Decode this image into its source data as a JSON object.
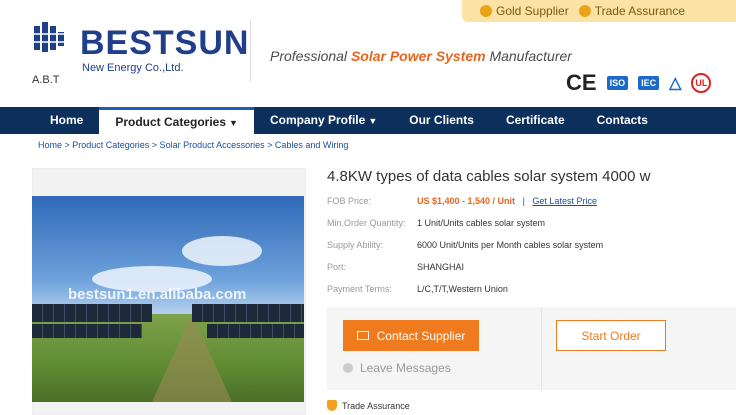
{
  "top_badges": [
    {
      "icon": "gold-supplier-icon",
      "label": "Gold Supplier"
    },
    {
      "icon": "trade-assurance-icon",
      "label": "Trade Assurance"
    }
  ],
  "logo": {
    "name": "BESTSUN",
    "subtitle": "New Energy Co.,Ltd.",
    "abbr": "A.B.T"
  },
  "tagline": {
    "pre": "Professional ",
    "highlight": "Solar Power System",
    "post": " Manufacturer"
  },
  "certifications": [
    "CE",
    "ISO",
    "IEC",
    "TÜV",
    "UL"
  ],
  "nav": {
    "items": [
      {
        "label": "Home"
      },
      {
        "label": "Product Categories",
        "caret": "▼"
      },
      {
        "label": "Company Profile",
        "caret": "▼"
      },
      {
        "label": "Our Clients"
      },
      {
        "label": "Certificate"
      },
      {
        "label": "Contacts"
      }
    ]
  },
  "breadcrumb": "Home > Product Categories > Solar Product Accessories > Cables and Wiring",
  "image": {
    "watermark": "bestsun1.en.alibaba.com"
  },
  "product": {
    "title": "4.8KW types of data cables solar system 4000 w",
    "fob_label": "FOB Price:",
    "fob_value": "US $1,400 - 1,540 / Unit",
    "pipe": "|",
    "latest_price_link": "Get Latest Price",
    "moq_label": "Min.Order Quantity:",
    "moq_value": "1 Unit/Units cables solar system",
    "supply_label": "Supply Ability:",
    "supply_value": "6000 Unit/Units per Month cables solar system",
    "port_label": "Port:",
    "port_value": "SHANGHAI",
    "payment_label": "Payment Terms:",
    "payment_value": "L/C,T/T,Western Union"
  },
  "actions": {
    "contact": "Contact Supplier",
    "start": "Start Order",
    "leave": "Leave Messages"
  },
  "trade_assurance": "Trade Assurance",
  "colors": {
    "nav_bg": "#0d2f5b",
    "accent": "#f07a1e",
    "brand": "#1f3f8a"
  }
}
